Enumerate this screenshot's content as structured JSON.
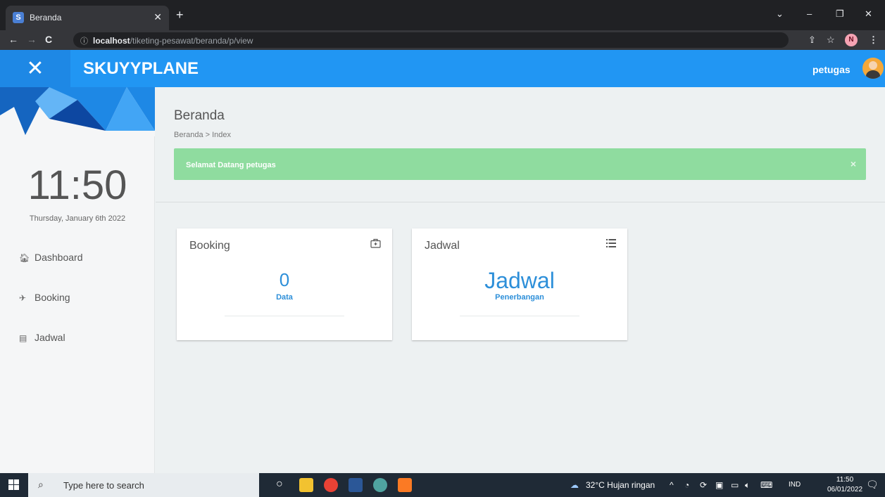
{
  "browser": {
    "tab_title": "Beranda",
    "tab_favicon": "S",
    "url_host": "localhost",
    "url_path": "/tiketing-pesawat/beranda/p/view",
    "profile_initial": "N"
  },
  "app": {
    "brand": "SKUYYPLANE",
    "close_symbol": "✕",
    "user_name": "petugas"
  },
  "sidebar": {
    "time": "11:50",
    "date": "Thursday, January 6th 2022",
    "items": [
      {
        "label": "Dashboard",
        "icon": "home-icon"
      },
      {
        "label": "Booking",
        "icon": "plane-icon"
      },
      {
        "label": "Jadwal",
        "icon": "list-icon"
      }
    ]
  },
  "main": {
    "title": "Beranda",
    "breadcrumb": "Beranda > Index",
    "alert": "Selamat Datang petugas",
    "alert_close": "×",
    "cards": [
      {
        "title": "Booking",
        "icon": "briefcase-icon",
        "value": "0",
        "sub": "Data"
      },
      {
        "title": "Jadwal",
        "icon": "list-icon",
        "value": "Jadwal",
        "sub": "Penerbangan"
      }
    ]
  },
  "taskbar": {
    "search_placeholder": "Type here to search",
    "weather": "32°C  Hujan ringan",
    "language": "IND",
    "time": "11:50",
    "date": "06/01/2022"
  },
  "colors": {
    "header_blue": "#2196f3",
    "accent_blue": "#2d8fd9",
    "alert_green": "#8fdc9f"
  }
}
